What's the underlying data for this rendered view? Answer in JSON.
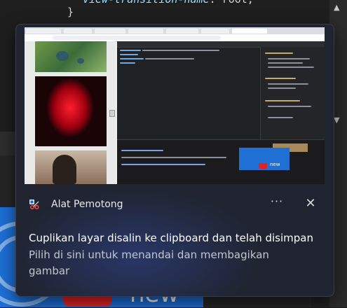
{
  "editor": {
    "line1_prop": "view-transition-name",
    "line1_rest": ": root;",
    "line2": "}"
  },
  "toast": {
    "app_name": "Alat Pemotong",
    "more_label": "···",
    "close_label": "✕",
    "title": "Cuplikan layar disalin ke clipboard dan telah disimpan",
    "body": "Pilih di sini untuk menandai dan membagikan gambar"
  },
  "background": {
    "thumbnail_text": "new"
  },
  "preview": {
    "card_text": "new"
  },
  "colors": {
    "toast_bg": "#1f2430",
    "accent_blue": "#1d6fd6",
    "youtube_red": "#e52222"
  }
}
